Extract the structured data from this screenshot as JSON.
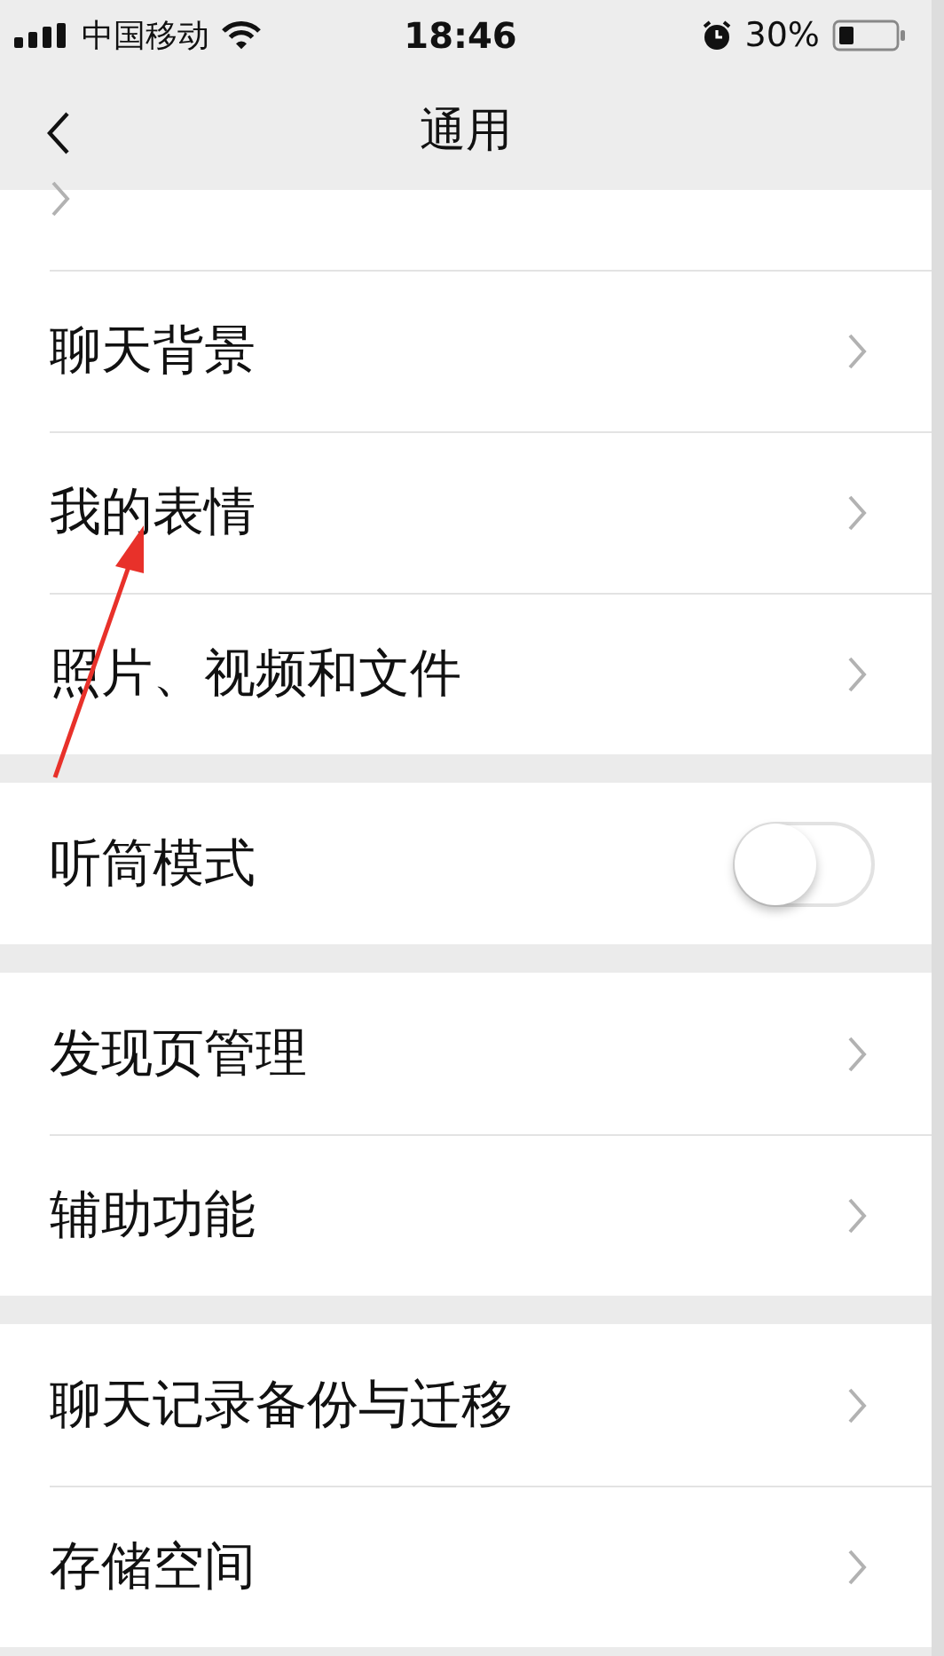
{
  "status_bar": {
    "carrier": "中国移动",
    "time": "18:46",
    "battery": "30%"
  },
  "nav": {
    "title": "通用"
  },
  "groups": [
    {
      "items": [
        {
          "kind": "link"
        },
        {
          "kind": "link",
          "label": "聊天背景"
        },
        {
          "kind": "link",
          "label": "我的表情"
        },
        {
          "kind": "link",
          "label": "照片、视频和文件"
        }
      ]
    },
    {
      "items": [
        {
          "kind": "toggle",
          "label": "听筒模式",
          "on": false
        }
      ]
    },
    {
      "items": [
        {
          "kind": "link",
          "label": "发现页管理"
        },
        {
          "kind": "link",
          "label": "辅助功能"
        }
      ]
    },
    {
      "items": [
        {
          "kind": "link",
          "label": "聊天记录备份与迁移"
        },
        {
          "kind": "link",
          "label": "存储空间"
        }
      ]
    }
  ]
}
